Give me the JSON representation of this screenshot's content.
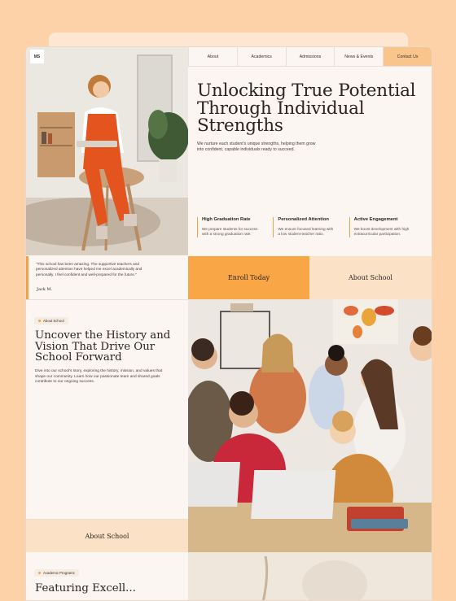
{
  "logo": "MS",
  "nav": {
    "items": [
      "About",
      "Academics",
      "Admissions",
      "News & Events"
    ],
    "contact": "Contact Us"
  },
  "hero": {
    "title": "Unlocking True Potential Through Individual Strengths",
    "subtitle": "We nurture each student's unique strengths, helping them grow into confident, capable individuals ready to succeed."
  },
  "stats": [
    {
      "title": "High Graduation Rate",
      "text": "We prepare students for success with a strong graduation rate."
    },
    {
      "title": "Personalized Attention",
      "text": "We ensure focused learning with a low student-teacher ratio."
    },
    {
      "title": "Active Engagement",
      "text": "We boost development with high extracurricular participation."
    }
  ],
  "testimonial": {
    "quote": "\"This school has been amazing. The supportive teachers and personalized attention have helped me excel academically and personally. I feel confident and well-prepared for the future.\"",
    "author": "Jack M."
  },
  "cta": {
    "enroll": "Enroll Today",
    "about": "About School"
  },
  "about": {
    "tag": "About School",
    "title": "Uncover the History and Vision That Drive Our School Forward",
    "text": "Dive into our school's story, exploring the history, mission, and values that shape our community. Learn how our passionate team and shared goals contribute to our ongoing success.",
    "button": "About School"
  },
  "programs": {
    "tag": "Academic Programs",
    "title": "Featuring Excell..."
  },
  "colors": {
    "accent": "#f9a647",
    "page_bg": "#fdd2a8",
    "card_bg": "#fbf6f1",
    "soft_accent": "#fbe1c6"
  }
}
